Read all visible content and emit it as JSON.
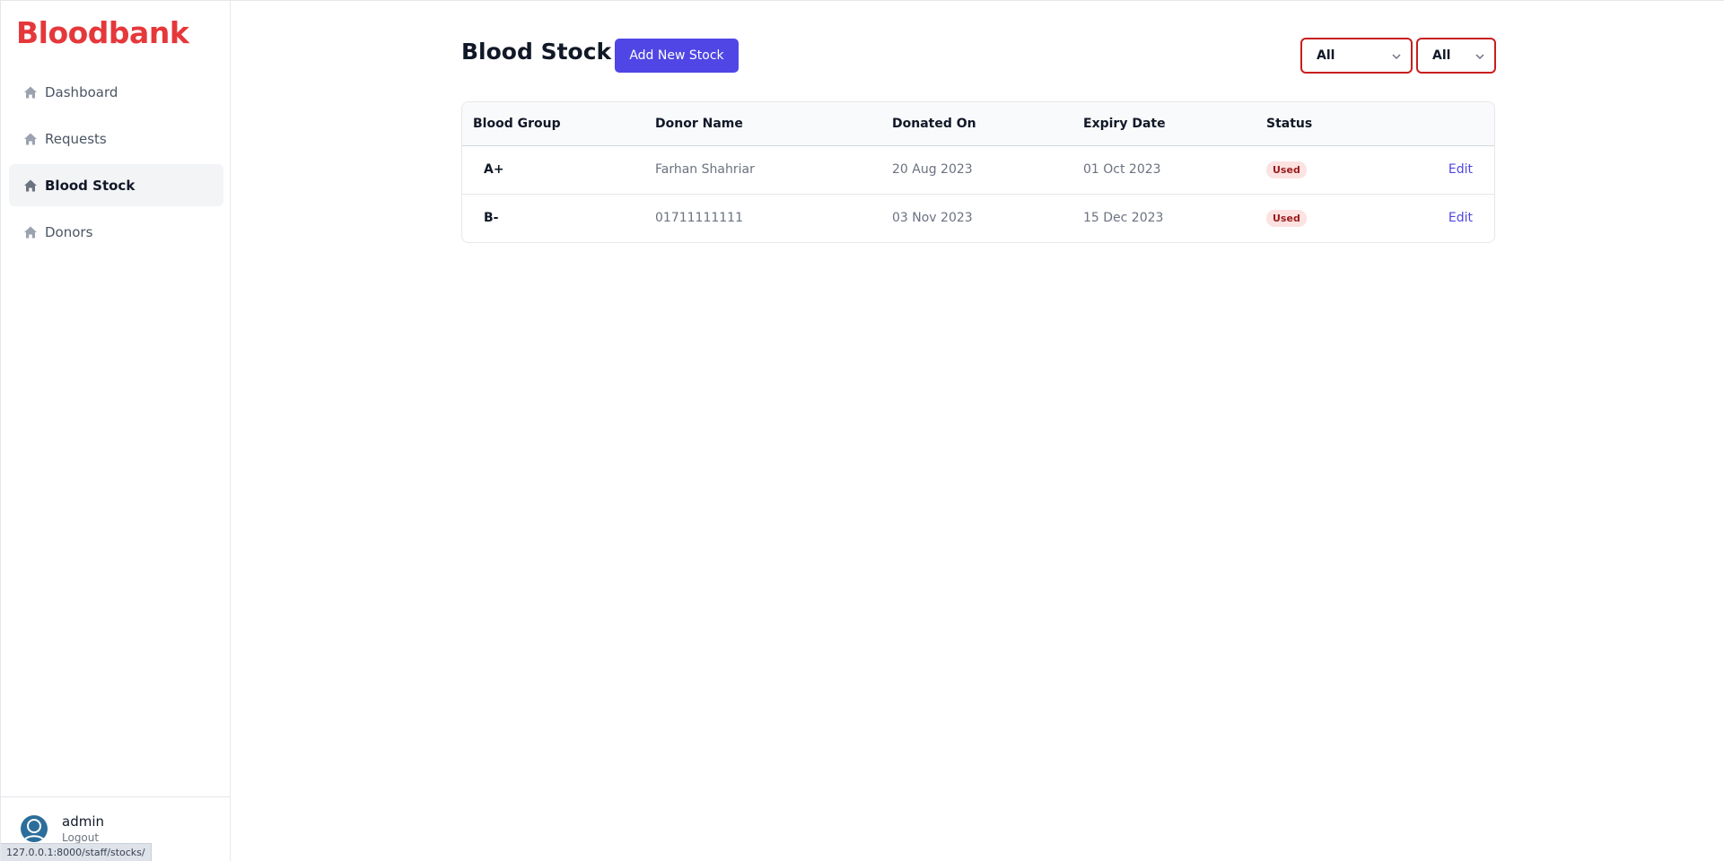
{
  "brand": "Bloodbank",
  "sidebar": {
    "items": [
      {
        "label": "Dashboard",
        "icon": "home-icon"
      },
      {
        "label": "Requests",
        "icon": "home-icon"
      },
      {
        "label": "Blood Stock",
        "icon": "home-icon",
        "active": true
      },
      {
        "label": "Donors",
        "icon": "home-icon"
      }
    ]
  },
  "user": {
    "name": "admin",
    "logout_label": "Logout"
  },
  "status_url": "127.0.0.1:8000/staff/stocks/",
  "page": {
    "title": "Blood Stock",
    "add_button_label": "Add New Stock",
    "filters": [
      {
        "selected": "All"
      },
      {
        "selected": "All"
      }
    ]
  },
  "table": {
    "headers": [
      "Blood Group",
      "Donor Name",
      "Donated On",
      "Expiry Date",
      "Status",
      ""
    ],
    "rows": [
      {
        "group": "A+",
        "donor": "Farhan Shahriar",
        "donated_on": "20 Aug 2023",
        "expiry": "01 Oct 2023",
        "status": "Used",
        "action": "Edit"
      },
      {
        "group": "B-",
        "donor": "01711111111",
        "donated_on": "03 Nov 2023",
        "expiry": "15 Dec 2023",
        "status": "Used",
        "action": "Edit"
      }
    ]
  },
  "colors": {
    "brand": "#e5383b",
    "accent": "#4f46e5",
    "filter_border": "#c81e1e",
    "badge_bg": "#fde2e2",
    "badge_text": "#9b1c1c"
  }
}
